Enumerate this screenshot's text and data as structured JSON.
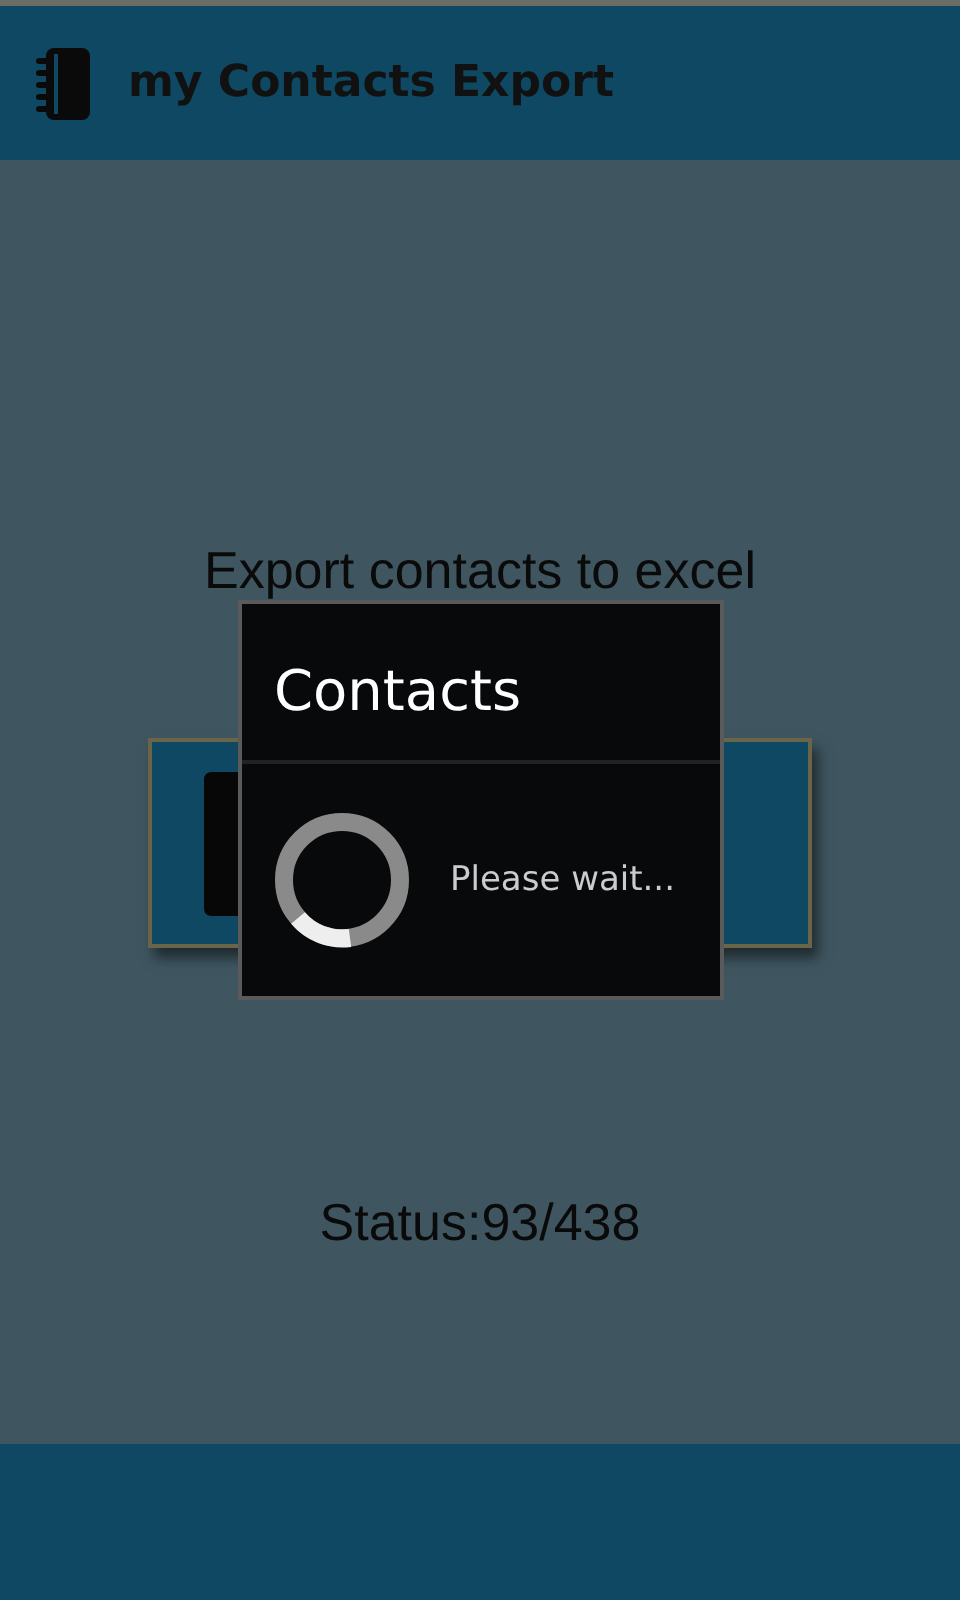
{
  "app_bar": {
    "title": "my Contacts Export"
  },
  "heading": "Export contacts to excel",
  "status": "Status:93/438",
  "dialog": {
    "title": "Contacts",
    "message": "Please wait..."
  }
}
